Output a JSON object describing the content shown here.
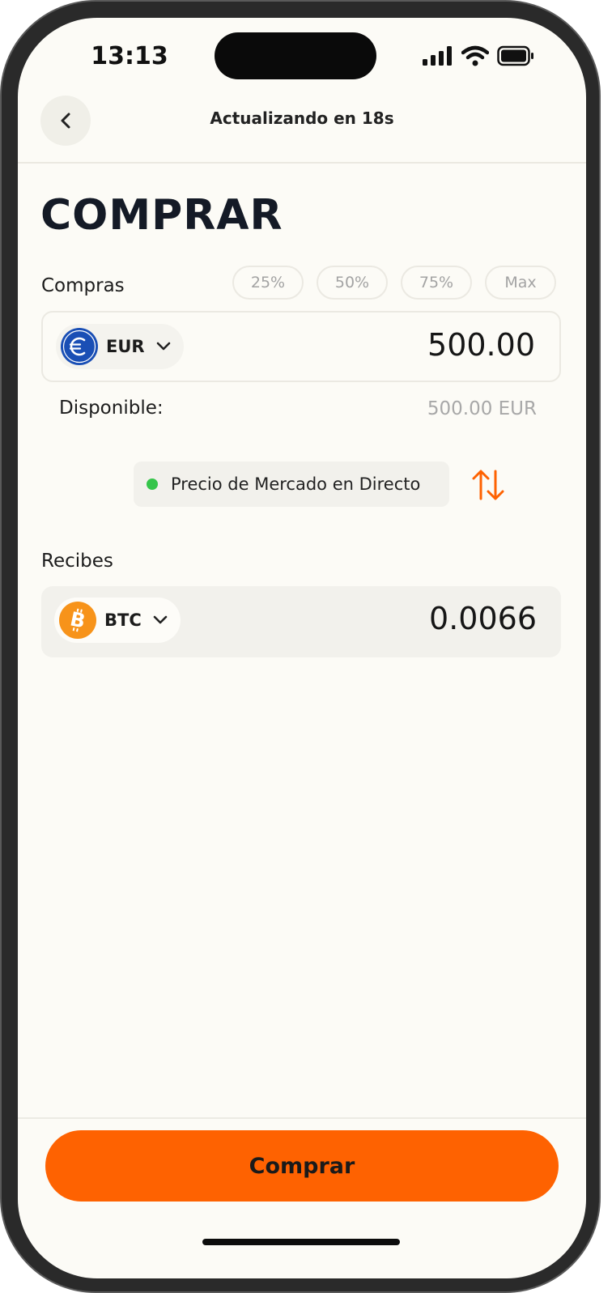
{
  "status_bar": {
    "time": "13:13"
  },
  "header": {
    "refresh_status": "Actualizando en  18s"
  },
  "page": {
    "title": "COMPRAR"
  },
  "pay": {
    "label": "Compras",
    "percent_options": [
      "25%",
      "50%",
      "75%",
      "Max"
    ],
    "currency": "EUR",
    "amount": "500.00",
    "available_label": "Disponible:",
    "available_value": "500.00 EUR"
  },
  "market": {
    "label": "Precio de Mercado en Directo"
  },
  "receive": {
    "label": "Recibes",
    "currency": "BTC",
    "amount": "0.0066"
  },
  "actions": {
    "buy_label": "Comprar"
  },
  "colors": {
    "accent": "#fe6201",
    "live": "#35c54a",
    "eur_coin": "#1a4fb5",
    "btc_coin": "#f7931a"
  },
  "icons": {
    "back": "chevron-left-icon",
    "swap": "swap-arrows-icon",
    "dropdown": "chevron-down-icon"
  }
}
